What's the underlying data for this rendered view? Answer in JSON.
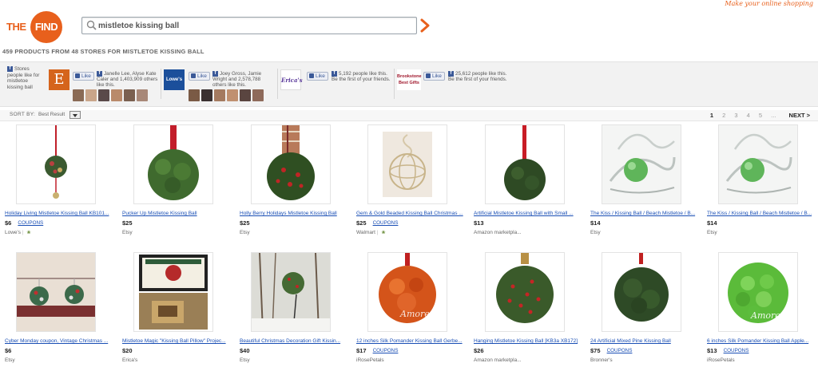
{
  "tagline": "Make your online shopping",
  "logo": {
    "prefix": "THE",
    "suffix": "FIND"
  },
  "search": {
    "value": "mistletoe kissing ball"
  },
  "results": {
    "text": "459 PRODUCTS FROM 48 STORES FOR MISTLETOE KISSING BALL"
  },
  "social": {
    "intro": "Stores people like for mistletoe kissing ball",
    "like_label": "Like",
    "stores": [
      {
        "logo_text": "E",
        "logo_color": "#d5641c",
        "like_text": "Janelle Lee, Alyse Kate Caler and 1,403,909 others like this."
      },
      {
        "logo_text": "Lowe's",
        "logo_color": "#1b4f9b",
        "like_text": "Joey Gross, Jamie Wright and 2,578,788 others like this."
      },
      {
        "logo_text": "Erica's",
        "logo_color": "#5b3a9b",
        "like_text": "5,192 people like this. Be the first of your friends."
      },
      {
        "logo_text": "Brookstone Best Gifts",
        "logo_color": "#a0182c",
        "like_text": "25,612 people like this. Be the first of your friends."
      }
    ]
  },
  "sort": {
    "label": "SORT BY:",
    "value": "Best Result"
  },
  "pagination": {
    "pages": [
      "1",
      "2",
      "3",
      "4",
      "5",
      "..."
    ],
    "current": "1",
    "next": "NEXT >"
  },
  "coupon_label": "COUPONS",
  "products": [
    {
      "title": "Holiday Living Mistletoe Kissing Ball KB101...",
      "price": "$6",
      "store": "Lowe's",
      "coupon": true,
      "leaf": true,
      "img": "ornament-small"
    },
    {
      "title": "Pucker Up Mistletoe Kissing Ball",
      "price": "$25",
      "store": "Etsy",
      "coupon": false,
      "leaf": false,
      "img": "green-ball-ribbon"
    },
    {
      "title": "Holly Berry Holidays Mistletoe Kissing Ball",
      "price": "$25",
      "store": "Etsy",
      "coupon": false,
      "leaf": false,
      "img": "plaid-ribbon-ball"
    },
    {
      "title": "Gem & Gold Beaded Kissing Ball Christmas ...",
      "price": "$25",
      "store": "Walmart",
      "coupon": true,
      "leaf": true,
      "img": "beaded-ball"
    },
    {
      "title": "Artificial Mistletoe Kissing Ball with Small ...",
      "price": "$13",
      "store": "Amazon marketpla...",
      "coupon": false,
      "leaf": false,
      "img": "dark-green-ball"
    },
    {
      "title": "The Kiss / Kissing Ball / Beach Mistletoe / B...",
      "price": "$14",
      "store": "Etsy",
      "coupon": false,
      "leaf": false,
      "img": "glass-sphere"
    },
    {
      "title": "The Kiss / Kissing Ball / Beach Mistletoe / B...",
      "price": "$14",
      "store": "Etsy",
      "coupon": false,
      "leaf": false,
      "img": "glass-sphere"
    },
    {
      "title": "Cyber Monday coupon, Vintage Christmas ...",
      "price": "$6",
      "store": "Etsy",
      "coupon": false,
      "leaf": false,
      "img": "vintage-pair"
    },
    {
      "title": "Mistletoe Magic \"Kissing Ball Pillow\" Projec...",
      "price": "$20",
      "store": "Erica's",
      "coupon": false,
      "leaf": false,
      "img": "pillow"
    },
    {
      "title": "Beautiful Christmas Decoration Gift Kissin...",
      "price": "$40",
      "store": "Etsy",
      "coupon": false,
      "leaf": false,
      "img": "outdoor-tree"
    },
    {
      "title": "12 inches Silk Pomander Kissing Ball Gerbe...",
      "price": "$17",
      "store": "iRosePetals",
      "coupon": true,
      "leaf": false,
      "img": "orange-pomander"
    },
    {
      "title": "Hanging Mistletoe Kissing Ball [KB3a XB172]",
      "price": "$26",
      "store": "Amazon marketpla...",
      "coupon": false,
      "leaf": false,
      "img": "holly-ball"
    },
    {
      "title": "24 Artificial Mixed Pine Kissing Ball",
      "price": "$75",
      "store": "Bronner's",
      "coupon": true,
      "leaf": false,
      "img": "pine-ball"
    },
    {
      "title": "6 inches Silk Pomander Kissing Ball Apple...",
      "price": "$13",
      "store": "iRosePetals",
      "coupon": true,
      "leaf": false,
      "img": "apple-pomander"
    }
  ]
}
